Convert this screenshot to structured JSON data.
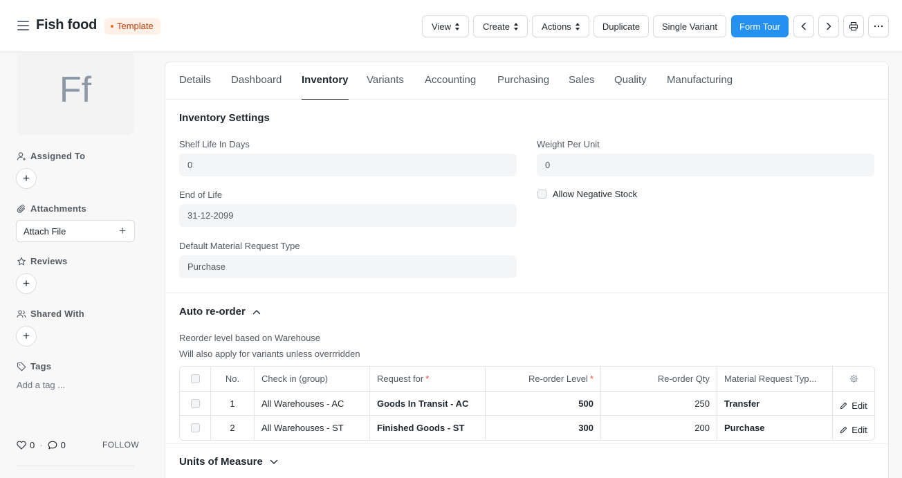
{
  "header": {
    "title": "Fish food",
    "badge": "Template",
    "buttons": {
      "view": "View",
      "create": "Create",
      "actions": "Actions",
      "duplicate": "Duplicate",
      "single_variant": "Single Variant",
      "form_tour": "Form Tour"
    }
  },
  "sidebar": {
    "avatar_initials": "Ff",
    "assigned_to": "Assigned To",
    "attachments": "Attachments",
    "attach_file": "Attach File",
    "reviews": "Reviews",
    "shared_with": "Shared With",
    "tags": "Tags",
    "add_tag": "Add a tag ...",
    "likes": "0",
    "comments": "0",
    "follow": "FOLLOW"
  },
  "tabs": [
    "Details",
    "Dashboard",
    "Inventory",
    "Variants",
    "Accounting",
    "Purchasing",
    "Sales",
    "Quality",
    "Manufacturing"
  ],
  "active_tab": "Inventory",
  "inventory": {
    "section_title": "Inventory Settings",
    "shelf_life_label": "Shelf Life In Days",
    "shelf_life_value": "0",
    "end_of_life_label": "End of Life",
    "end_of_life_value": "31-12-2099",
    "material_request_label": "Default Material Request Type",
    "material_request_value": "Purchase",
    "weight_per_unit_label": "Weight Per Unit",
    "weight_per_unit_value": "0",
    "allow_negative_label": "Allow Negative Stock"
  },
  "reorder": {
    "section_title": "Auto re-order",
    "line1": "Reorder level based on Warehouse",
    "line2": "Will also apply for variants unless overrridden",
    "columns": {
      "no": "No.",
      "check_in": "Check in (group)",
      "request_for": "Request for",
      "level": "Re-order Level",
      "qty": "Re-order Qty",
      "type": "Material Request Typ..."
    },
    "rows": [
      {
        "no": "1",
        "check_in": "All Warehouses - AC",
        "request_for": "Goods In Transit - AC",
        "level": "500",
        "qty": "250",
        "type": "Transfer",
        "edit": "Edit"
      },
      {
        "no": "2",
        "check_in": "All Warehouses - ST",
        "request_for": "Finished Goods - ST",
        "level": "300",
        "qty": "200",
        "type": "Purchase",
        "edit": "Edit"
      }
    ]
  },
  "uom": {
    "section_title": "Units of Measure"
  },
  "colors": {
    "primary": "#2490ef",
    "badge_text": "#c2410c",
    "badge_bg": "#fff1e7",
    "required": "#e24c4c"
  }
}
